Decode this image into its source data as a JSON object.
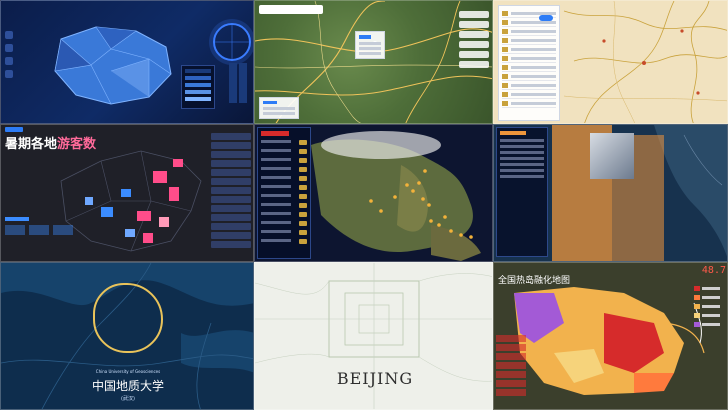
{
  "tiles": {
    "t1": {
      "title": "",
      "colors": {
        "bg": "#0b1d4a",
        "region": "#3a79d8",
        "accent": "#3a7cff"
      }
    },
    "t2": {
      "colors": {
        "bg": "#4e6e39",
        "road": "#f0c35a"
      }
    },
    "t3": {
      "colors": {
        "bg": "#f1e2bf",
        "border": "#c9a23c",
        "label": "#c74b2a"
      }
    },
    "t4": {
      "title_pink": "暑期各地",
      "title_white": "游客数",
      "colors": {
        "bg": "#1f2028",
        "hot": "#ff4d8a",
        "cool": "#3b8cff"
      }
    },
    "t5": {
      "colors": {
        "bg": "#0d1530",
        "dot": "#f3b23a"
      }
    },
    "t6": {
      "colors": {
        "bg": "#17324e",
        "swath": "#ee963c"
      }
    },
    "t7": {
      "title_cn": "中国地质大学",
      "title_en": "China University of Geosciences",
      "subtitle": "(武汉)",
      "colors": {
        "bg": "#0e2d4d",
        "outline": "#e9c35a"
      }
    },
    "t8": {
      "title": "BEIJING",
      "colors": {
        "bg": "#eef0ea",
        "road": "#b9c7b0"
      }
    },
    "t9": {
      "title": "全国热岛融化地图",
      "badge": "",
      "temperature": "48.7",
      "legend_colors": [
        "#d62b2b",
        "#ff7a3d",
        "#f2b24d",
        "#f6d37b",
        "#a35ad6"
      ],
      "colors": {
        "bg": "#3b3f2c",
        "hot": "#d62b2b",
        "warm": "#f2b24d",
        "purple": "#a35ad6"
      }
    }
  }
}
